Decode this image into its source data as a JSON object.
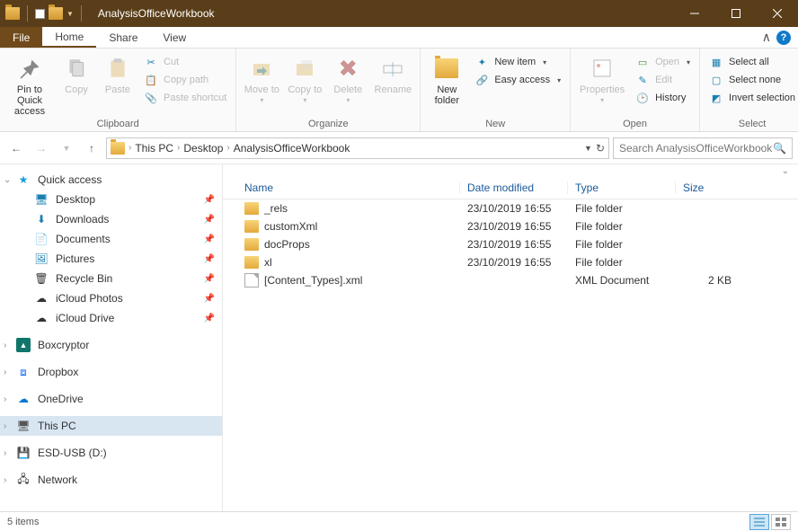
{
  "window": {
    "title": "AnalysisOfficeWorkbook"
  },
  "tabs": {
    "file": "File",
    "home": "Home",
    "share": "Share",
    "view": "View"
  },
  "ribbon": {
    "clipboard": {
      "label": "Clipboard",
      "pin": "Pin to Quick access",
      "copy": "Copy",
      "paste": "Paste",
      "cut": "Cut",
      "copypath": "Copy path",
      "pasteshortcut": "Paste shortcut"
    },
    "organize": {
      "label": "Organize",
      "moveto": "Move to",
      "copyto": "Copy to",
      "delete": "Delete",
      "rename": "Rename"
    },
    "new": {
      "label": "New",
      "newfolder": "New folder",
      "newitem": "New item",
      "easyaccess": "Easy access"
    },
    "open": {
      "label": "Open",
      "properties": "Properties",
      "open": "Open",
      "edit": "Edit",
      "history": "History"
    },
    "select": {
      "label": "Select",
      "selectall": "Select all",
      "selectnone": "Select none",
      "invert": "Invert selection"
    }
  },
  "breadcrumbs": [
    "This PC",
    "Desktop",
    "AnalysisOfficeWorkbook"
  ],
  "search": {
    "placeholder": "Search AnalysisOfficeWorkbook"
  },
  "nav": {
    "quickaccess": "Quick access",
    "desktop": "Desktop",
    "downloads": "Downloads",
    "documents": "Documents",
    "pictures": "Pictures",
    "recyclebin": "Recycle Bin",
    "icloudphotos": "iCloud Photos",
    "iclouddrive": "iCloud Drive",
    "boxcryptor": "Boxcryptor",
    "dropbox": "Dropbox",
    "onedrive": "OneDrive",
    "thispc": "This PC",
    "esdusb": "ESD-USB (D:)",
    "network": "Network"
  },
  "columns": {
    "name": "Name",
    "date": "Date modified",
    "type": "Type",
    "size": "Size"
  },
  "files": [
    {
      "icon": "folder",
      "name": "_rels",
      "date": "23/10/2019 16:55",
      "type": "File folder",
      "size": ""
    },
    {
      "icon": "folder",
      "name": "customXml",
      "date": "23/10/2019 16:55",
      "type": "File folder",
      "size": ""
    },
    {
      "icon": "folder",
      "name": "docProps",
      "date": "23/10/2019 16:55",
      "type": "File folder",
      "size": ""
    },
    {
      "icon": "folder",
      "name": "xl",
      "date": "23/10/2019 16:55",
      "type": "File folder",
      "size": ""
    },
    {
      "icon": "file",
      "name": "[Content_Types].xml",
      "date": "",
      "type": "XML Document",
      "size": "2 KB"
    }
  ],
  "status": {
    "count": "5 items"
  }
}
